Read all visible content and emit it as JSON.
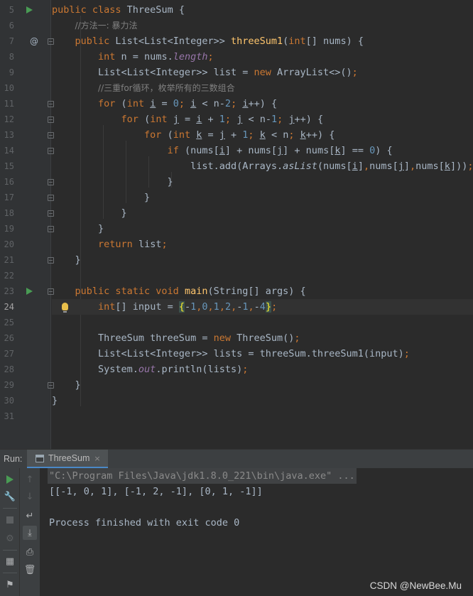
{
  "editor": {
    "line_numbers": [
      "5",
      "6",
      "7",
      "8",
      "9",
      "10",
      "11",
      "12",
      "13",
      "14",
      "15",
      "16",
      "17",
      "18",
      "19",
      "20",
      "21",
      "22",
      "23",
      "24",
      "25",
      "26",
      "27",
      "28",
      "29",
      "30",
      "31"
    ],
    "current_line": "24",
    "comments": {
      "method1": "//方法一: 暴力法",
      "triple_loop": "//三重for循环，枚举所有的三数组合"
    },
    "identifiers": {
      "class_name": "ThreeSum",
      "method_name": "threeSum1",
      "main_name": "main"
    }
  },
  "run_panel": {
    "label": "Run:",
    "tab_label": "ThreeSum",
    "close_glyph": "×"
  },
  "console": {
    "command": "\"C:\\Program Files\\Java\\jdk1.8.0_221\\bin\\java.exe\" ...",
    "output": "[[-1, 0, 1], [-1, 2, -1], [0, 1, -1]]",
    "exit_message": "Process finished with exit code 0"
  },
  "watermark": "CSDN @NewBee.Mu",
  "colors": {
    "keyword": "#cc7832",
    "number": "#6897bb",
    "method": "#ffc66d",
    "comment": "#808080",
    "static_field": "#9876aa",
    "run_green": "#499c54",
    "tab_underline": "#4a88c7"
  }
}
